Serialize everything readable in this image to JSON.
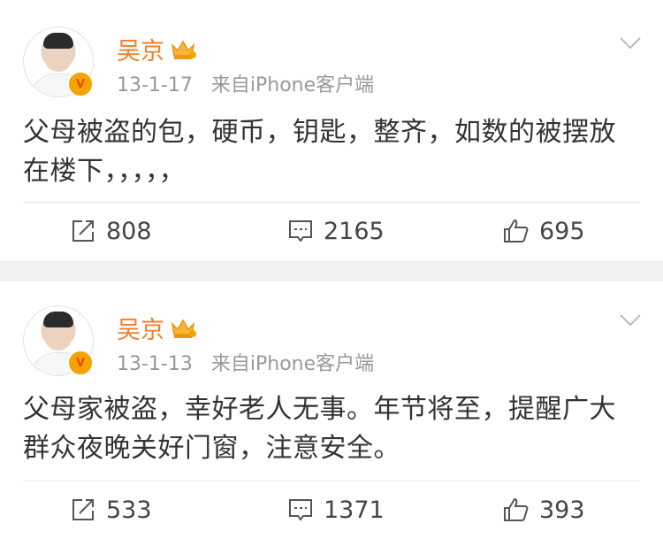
{
  "accent": "#f47d2a",
  "posts": [
    {
      "author": "吴京",
      "time": "13-1-17",
      "source": "来自iPhone客户端",
      "text": "父母被盗的包，硬币，钥匙，整齐，如数的被摆放在楼下，，，，，",
      "reposts": "808",
      "comments": "2165",
      "likes": "695"
    },
    {
      "author": "吴京",
      "time": "13-1-13",
      "source": "来自iPhone客户端",
      "text": "父母家被盗，幸好老人无事。年节将至，提醒广大群众夜晚关好门窗，注意安全。",
      "reposts": "533",
      "comments": "1371",
      "likes": "393"
    }
  ]
}
